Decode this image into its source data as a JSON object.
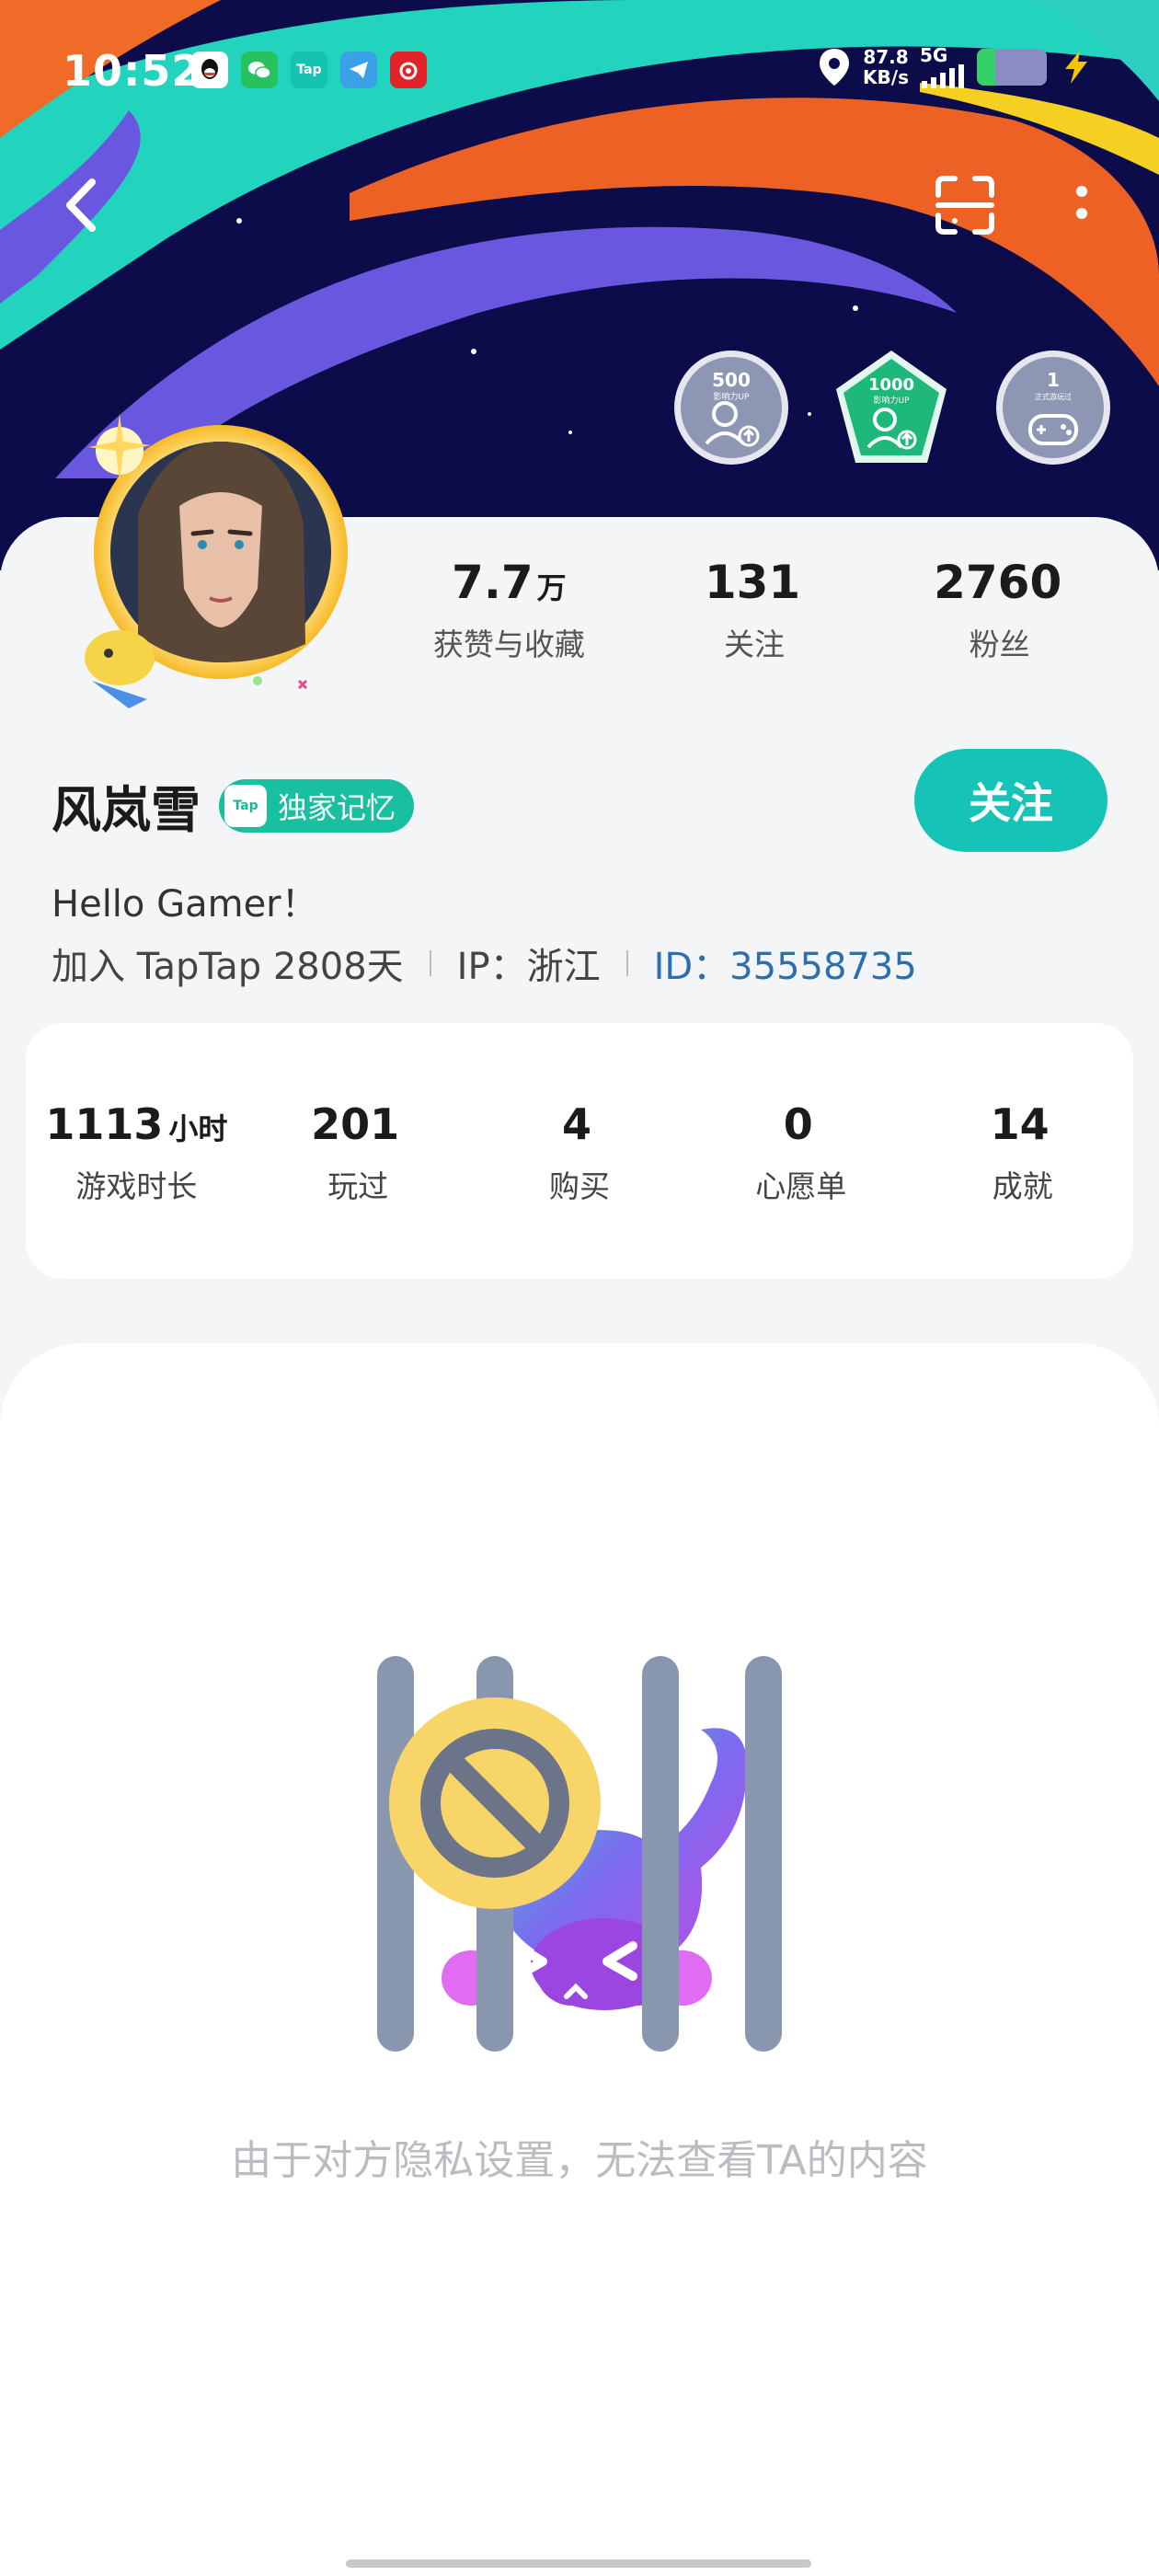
{
  "status_bar": {
    "time": "10:52",
    "net_speed_value": "87.8",
    "net_speed_unit": "KB/s",
    "network": "5G",
    "notification_icons": [
      "qq-icon",
      "wechat-icon",
      "taptap-icon",
      "telegram-icon",
      "netease-music-icon"
    ]
  },
  "nav": {
    "back_icon": "chevron-left-icon",
    "scan_icon": "scan-icon",
    "more_icon": "more-vertical-icon"
  },
  "badges": [
    {
      "value": "500",
      "sub": "影响力UP",
      "icon": "user-up-icon",
      "active": false
    },
    {
      "value": "1000",
      "sub": "影响力UP",
      "icon": "user-up-icon",
      "active": true
    },
    {
      "value": "1",
      "sub": "正式游玩过",
      "icon": "gamepad-icon",
      "active": false
    }
  ],
  "profile": {
    "stats": [
      {
        "num": "7.7",
        "unit": "万",
        "label": "获赞与收藏"
      },
      {
        "num": "131",
        "unit": "",
        "label": "关注"
      },
      {
        "num": "2760",
        "unit": "",
        "label": "粉丝"
      }
    ],
    "name": "风岚雪",
    "tag_label": "独家记忆",
    "tag_icon_text": "Tap",
    "follow_label": "关注",
    "bio": "Hello Gamer！",
    "joined": "加入 TapTap 2808天",
    "ip": "IP：浙江",
    "id": "ID：35558735"
  },
  "game_stats": [
    {
      "num": "1113",
      "unit": "小时",
      "label": "游戏时长"
    },
    {
      "num": "201",
      "unit": "",
      "label": "玩过"
    },
    {
      "num": "4",
      "unit": "",
      "label": "购买"
    },
    {
      "num": "0",
      "unit": "",
      "label": "心愿单"
    },
    {
      "num": "14",
      "unit": "",
      "label": "成就"
    }
  ],
  "empty_state": {
    "message": "由于对方隐私设置，无法查看TA的内容"
  },
  "colors": {
    "accent": "#15c4b6",
    "id_link": "#2a6fb0",
    "banner_bg": "#0d0c4a"
  }
}
